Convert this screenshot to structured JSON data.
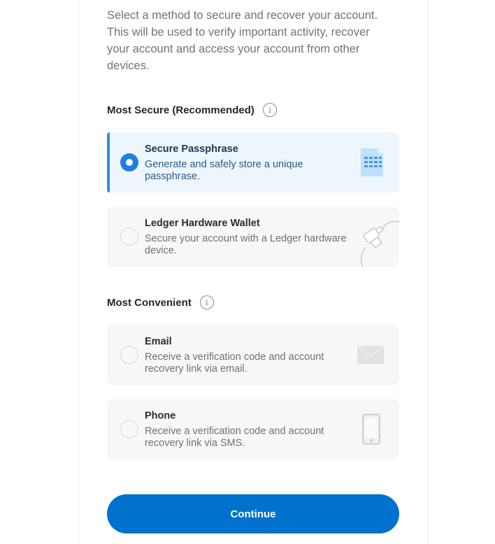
{
  "intro": "Select a method to secure and recover your account. This will be used to verify important activity, recover your account and access your account from other devices.",
  "sections": [
    {
      "title": "Most Secure (Recommended)",
      "options": [
        {
          "title": "Secure Passphrase",
          "description": "Generate and safely store a unique passphrase.",
          "selected": true,
          "icon": "document-icon"
        },
        {
          "title": "Ledger Hardware Wallet",
          "description": "Secure your account with a Ledger hardware device.",
          "selected": false,
          "icon": "usb-device-icon"
        }
      ]
    },
    {
      "title": "Most Convenient",
      "options": [
        {
          "title": "Email",
          "description": "Receive a verification code and account recovery link via email.",
          "selected": false,
          "icon": "envelope-icon"
        },
        {
          "title": "Phone",
          "description": "Receive a verification code and account recovery link via SMS.",
          "selected": false,
          "icon": "phone-icon"
        }
      ]
    }
  ],
  "continue_label": "Continue",
  "colors": {
    "accent": "#0072ce",
    "selected_bg": "#eef6fd",
    "selected_border": "#2f8fe6"
  }
}
